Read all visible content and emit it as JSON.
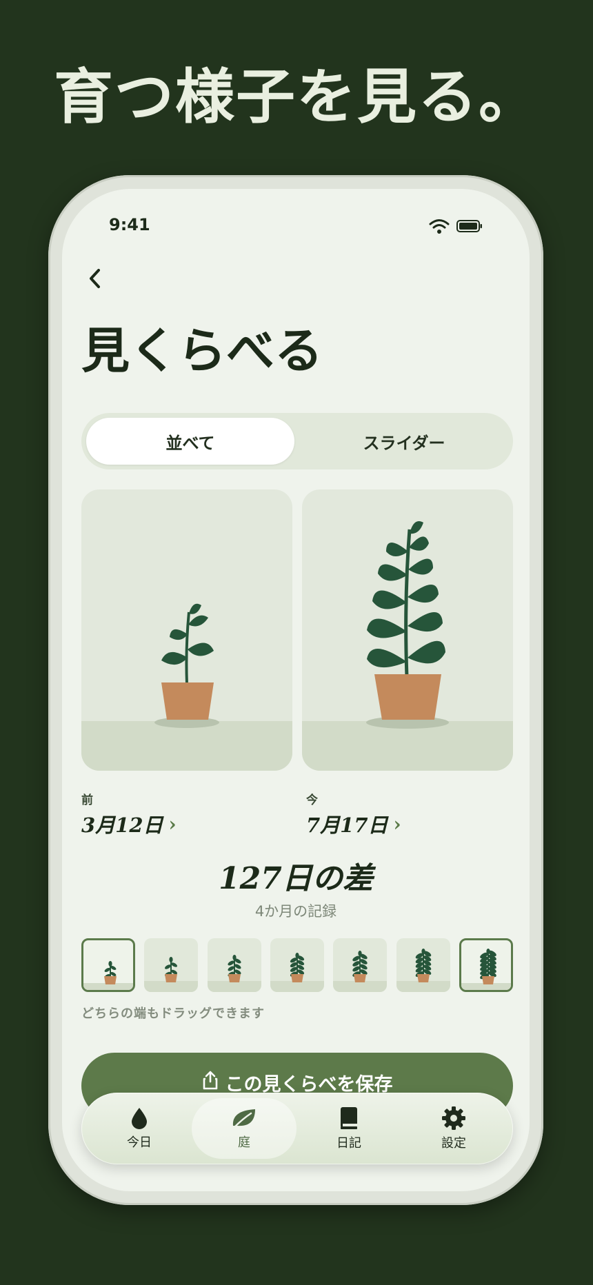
{
  "headline": "育つ様子を見る。",
  "status": {
    "time": "9:41"
  },
  "page": {
    "title": "見くらべる"
  },
  "segmented": {
    "options": [
      "並べて",
      "スライダー"
    ],
    "selected": "並べて"
  },
  "before": {
    "label": "前",
    "date": "3月12日"
  },
  "after": {
    "label": "今",
    "date": "7月17日"
  },
  "difference": {
    "value": "127日の差",
    "subtitle": "4か月の記録"
  },
  "timeline": {
    "count": 7,
    "selected": [
      0,
      6
    ]
  },
  "hint": "どちらの端もドラッグできます",
  "save_button": {
    "label": "この見くらべを保存"
  },
  "tabbar": {
    "items": [
      {
        "label": "今日",
        "icon": "water-drop-icon"
      },
      {
        "label": "庭",
        "icon": "leaf-icon"
      },
      {
        "label": "日記",
        "icon": "book-icon"
      },
      {
        "label": "設定",
        "icon": "gear-icon"
      }
    ],
    "active": "庭"
  },
  "colors": {
    "accent": "#5d7a4a",
    "leaf": "#26553a",
    "pot": "#c48a5c",
    "background": "#22341d"
  }
}
